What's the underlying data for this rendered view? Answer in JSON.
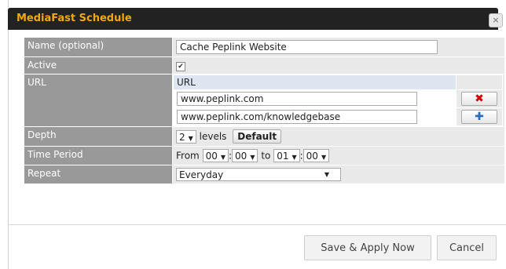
{
  "dialog": {
    "title": "MediaFast Schedule",
    "close_label": "×"
  },
  "form": {
    "name": {
      "label": "Name (optional)",
      "value": "Cache Peplink Website"
    },
    "active": {
      "label": "Active",
      "checked": true,
      "check_glyph": "✔"
    },
    "url": {
      "label": "URL",
      "header": "URL",
      "entries": [
        "www.peplink.com",
        "www.peplink.com/knowledgebase"
      ],
      "delete_glyph": "✖",
      "add_glyph": "✚"
    },
    "depth": {
      "label": "Depth",
      "value": "2",
      "unit": "levels",
      "default_button": "Default"
    },
    "time_period": {
      "label": "Time Period",
      "from_text": "From",
      "to_text": "to",
      "separator": ":",
      "from_hour": "00",
      "from_minute": "00",
      "to_hour": "01",
      "to_minute": "00"
    },
    "repeat": {
      "label": "Repeat",
      "value": "Everyday"
    }
  },
  "caret_glyph": "▼",
  "buttons": {
    "save": "Save & Apply Now",
    "cancel": "Cancel"
  },
  "colors": {
    "title_bg": "#222222",
    "title_text": "#f5a800",
    "label_bg": "#999999",
    "value_bg": "#e9e9e9",
    "delete": "#d40000",
    "add": "#2a6ebb"
  }
}
